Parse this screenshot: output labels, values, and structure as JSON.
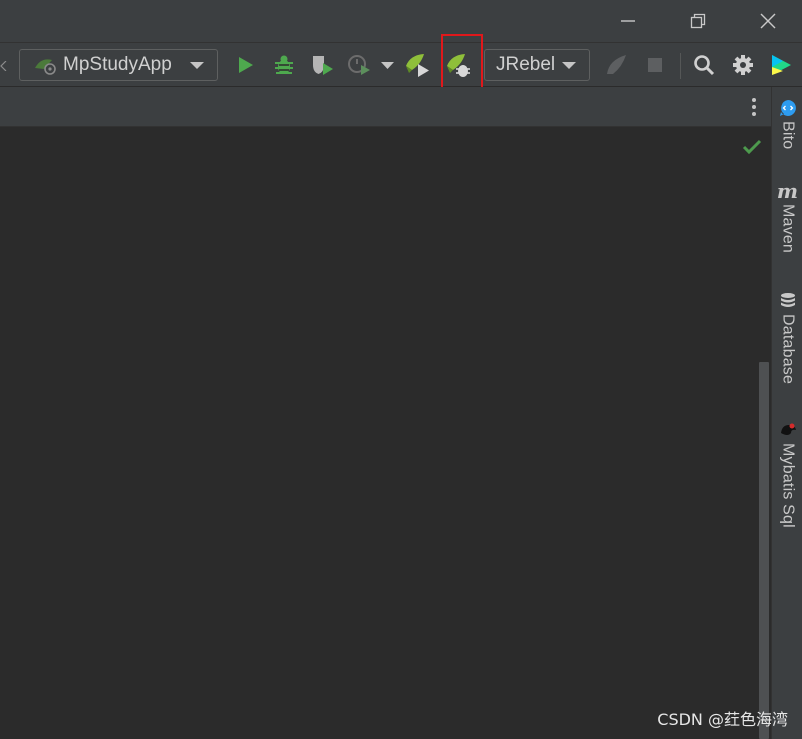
{
  "toolbar": {
    "run_config": "MpStudyApp",
    "jrebel_config": "JRebel"
  },
  "sidebar": {
    "items": [
      {
        "label": "Bito",
        "icon": "bito-icon"
      },
      {
        "label": "Maven",
        "icon": "maven-icon"
      },
      {
        "label": "Database",
        "icon": "database-icon"
      },
      {
        "label": "Mybatis Sql",
        "icon": "mybatis-icon"
      }
    ]
  },
  "watermark": "CSDN @荭色海湾",
  "colors": {
    "run_green": "#4ea94e",
    "highlight_red": "#e0181b",
    "check_green": "#4d9a4d"
  }
}
